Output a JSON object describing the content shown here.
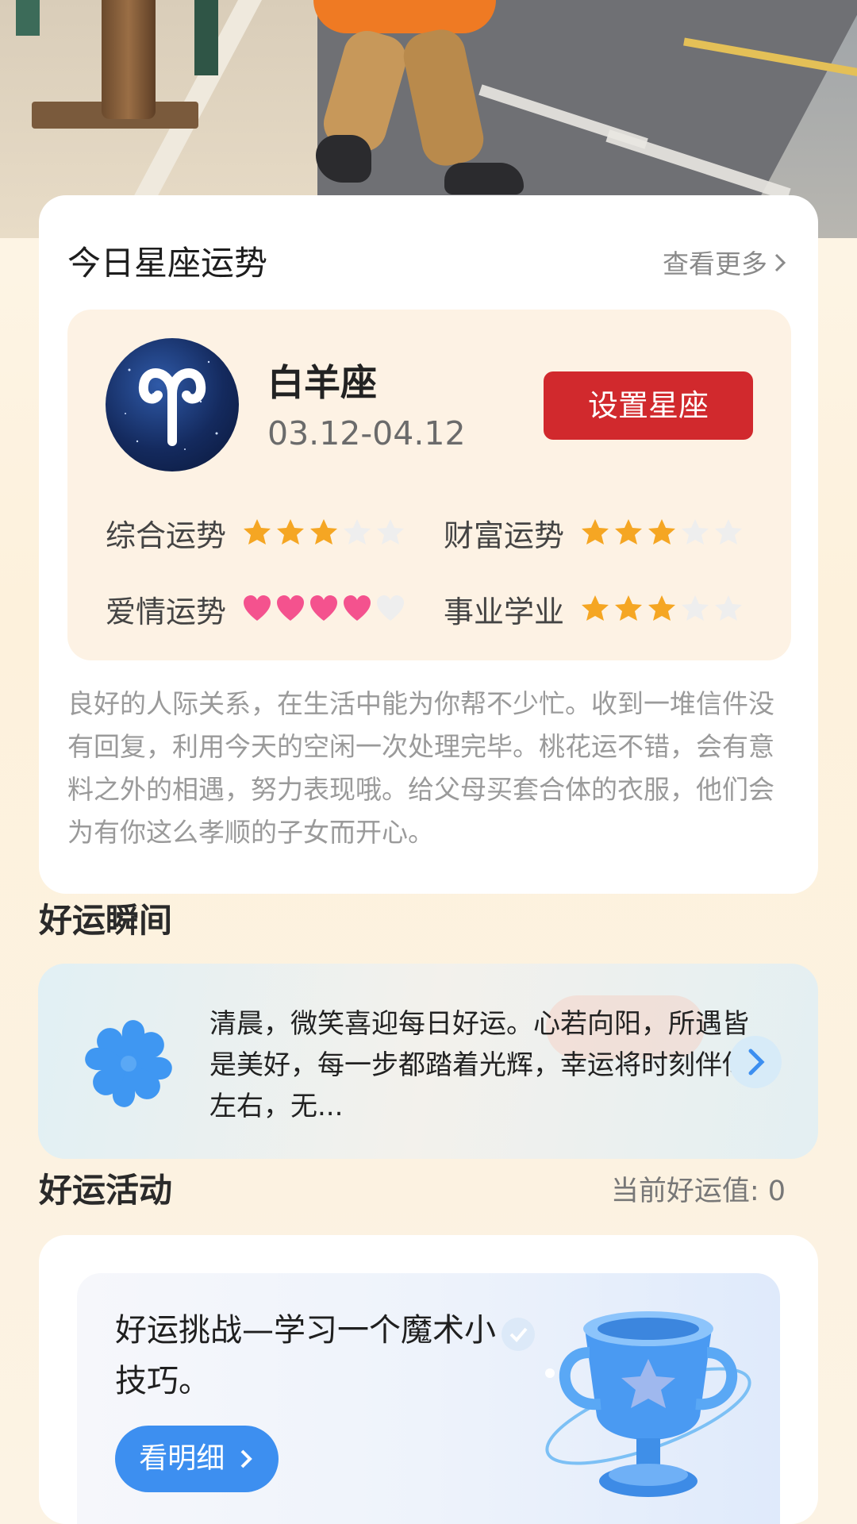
{
  "horoscope": {
    "title": "今日星座运势",
    "see_more": "查看更多",
    "sign_name": "白羊座",
    "sign_date": "03.12-04.12",
    "set_button": "设置星座",
    "ratings": [
      {
        "label": "综合运势",
        "value": 3,
        "max": 5,
        "icon": "star-icon"
      },
      {
        "label": "财富运势",
        "value": 3,
        "max": 5,
        "icon": "star-icon"
      },
      {
        "label": "爱情运势",
        "value": 4,
        "max": 5,
        "icon": "heart-icon"
      },
      {
        "label": "事业学业",
        "value": 3,
        "max": 5,
        "icon": "star-icon"
      }
    ],
    "description": "良好的人际关系，在生活中能为你帮不少忙。收到一堆信件没有回复，利用今天的空闲一次处理完毕。桃花运不错，会有意料之外的相遇，努力表现哦。给父母买套合体的衣服，他们会为有你这么孝顺的子女而开心。"
  },
  "lucky_moment": {
    "title": "好运瞬间",
    "text": "清晨，微笑喜迎每日好运。心若向阳，所遇皆是美好，每一步都踏着光辉，幸运将时刻伴你左右，无..."
  },
  "lucky_activity": {
    "title": "好运活动",
    "current_value": "当前好运值: 0",
    "challenge_title": "好运挑战—学习一个魔术小技巧。",
    "detail_button": "看明细"
  },
  "colors": {
    "accent_red": "#d1292d",
    "star_orange": "#f5a623",
    "heart_pink": "#f4528e",
    "button_blue": "#3d8ff0",
    "clover_blue": "#3f97f2"
  }
}
